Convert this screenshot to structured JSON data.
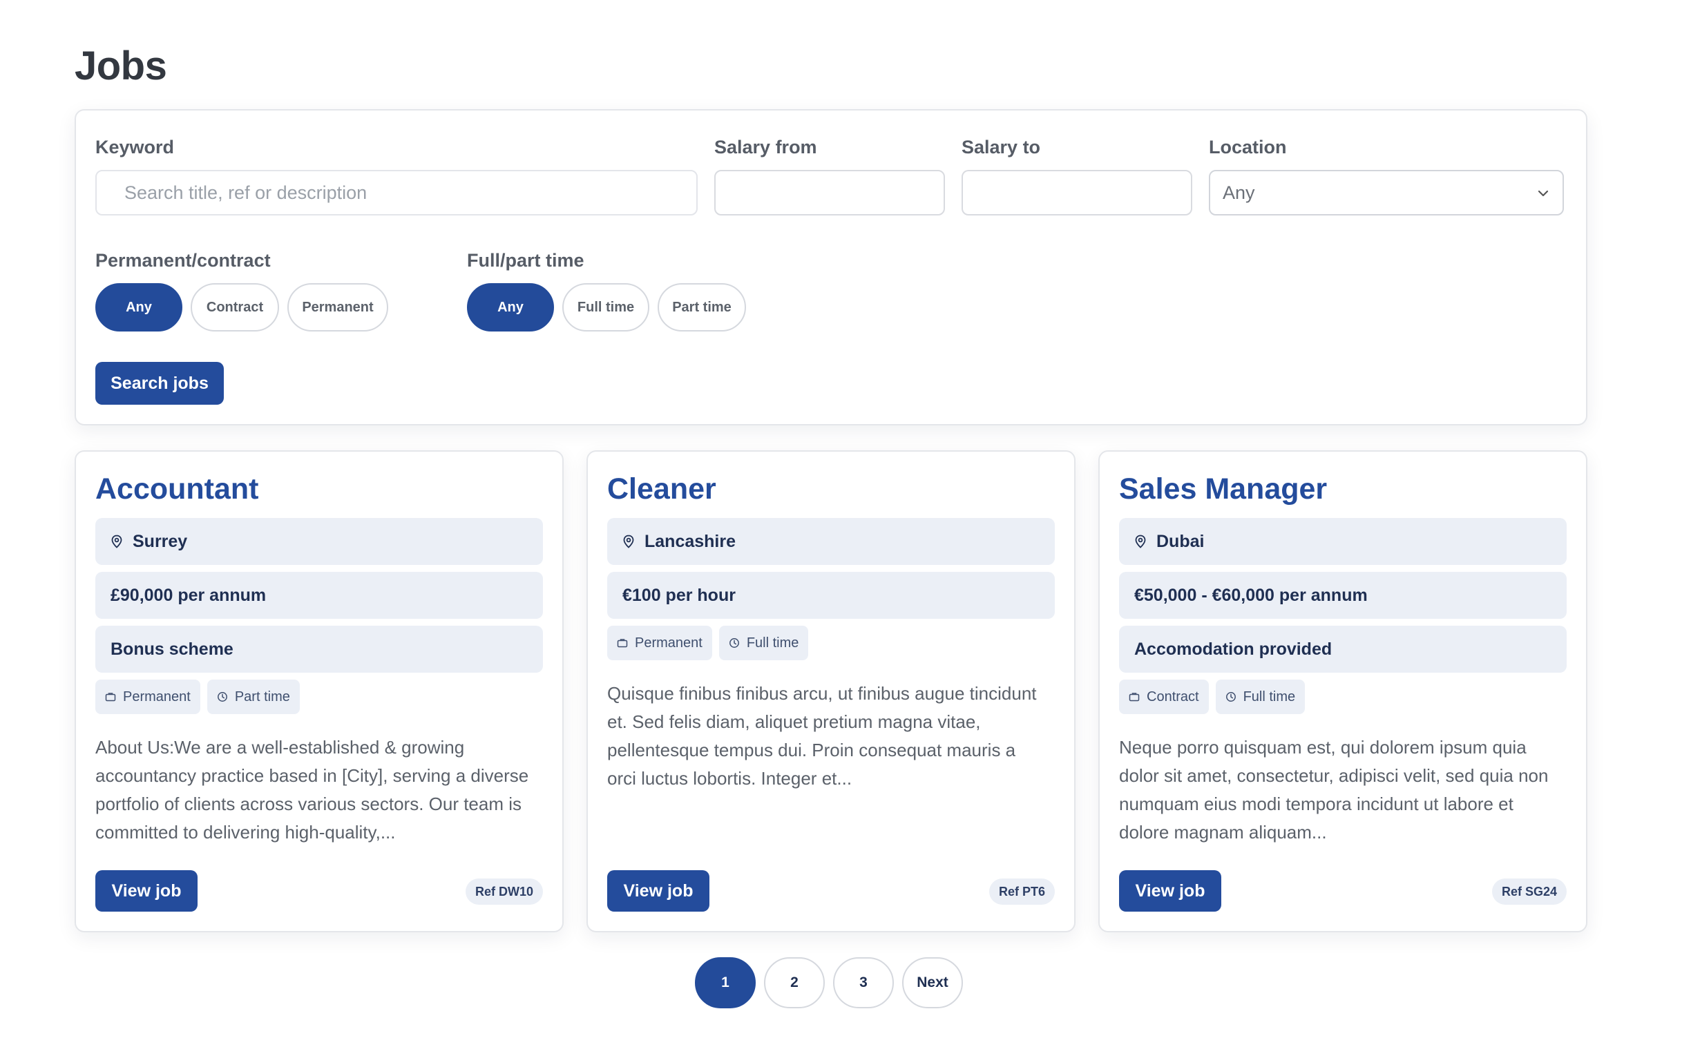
{
  "page": {
    "title": "Jobs"
  },
  "filters": {
    "keyword": {
      "label": "Keyword",
      "placeholder": "Search title, ref or description",
      "value": ""
    },
    "salary_from": {
      "label": "Salary from",
      "value": ""
    },
    "salary_to": {
      "label": "Salary to",
      "value": ""
    },
    "location": {
      "label": "Location",
      "selected": "Any"
    },
    "contract_type": {
      "label": "Permanent/contract",
      "options": [
        "Any",
        "Contract",
        "Permanent"
      ],
      "active": "Any"
    },
    "hours": {
      "label": "Full/part time",
      "options": [
        "Any",
        "Full time",
        "Part time"
      ],
      "active": "Any"
    },
    "search_label": "Search jobs"
  },
  "jobs": [
    {
      "title": "Accountant",
      "location": "Surrey",
      "salary": "£90,000 per annum",
      "benefit": "Bonus scheme",
      "contract": "Permanent",
      "hours": "Part time",
      "description": "About Us:We are a well-established & growing accountancy practice based in [City], serving a diverse portfolio of clients across various sectors. Our team is committed to delivering high-quality,...",
      "view_label": "View job",
      "ref": "Ref DW10"
    },
    {
      "title": "Cleaner",
      "location": "Lancashire",
      "salary": "€100 per hour",
      "contract": "Permanent",
      "hours": "Full time",
      "description": "Quisque finibus finibus arcu, ut finibus augue tincidunt et. Sed felis diam, aliquet pretium magna vitae, pellentesque tempus dui. Proin consequat mauris a orci luctus lobortis. Integer et...",
      "view_label": "View job",
      "ref": "Ref PT6"
    },
    {
      "title": "Sales Manager",
      "location": "Dubai",
      "salary": "€50,000 - €60,000 per annum",
      "benefit": "Accomodation provided",
      "contract": "Contract",
      "hours": "Full time",
      "description": "Neque porro quisquam est, qui dolorem ipsum quia dolor sit amet, consectetur, adipisci velit, sed quia non numquam eius modi tempora incidunt ut labore et dolore magnam aliquam...",
      "view_label": "View job",
      "ref": "Ref SG24"
    }
  ],
  "pagination": {
    "pages": [
      "1",
      "2",
      "3"
    ],
    "current": "1",
    "next_label": "Next"
  },
  "colors": {
    "primary": "#244c9c",
    "chip_bg": "#ebeff6",
    "border": "#e4e6ea"
  }
}
